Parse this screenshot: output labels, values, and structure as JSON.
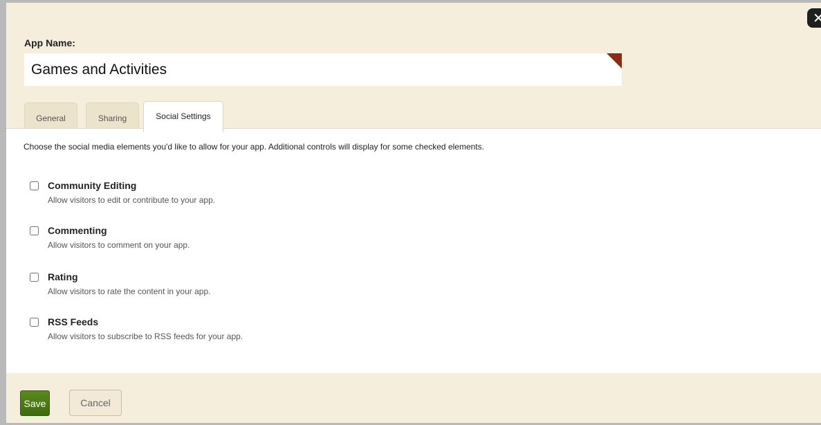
{
  "dialog": {
    "close_icon": "close-icon",
    "app_name_label": "App Name:",
    "app_name_value": "Games and Activities"
  },
  "tabs": [
    {
      "label": "General",
      "active": false
    },
    {
      "label": "Sharing",
      "active": false
    },
    {
      "label": "Social Settings",
      "active": true
    }
  ],
  "social": {
    "intro": "Choose the social media elements you'd like to allow for your app. Additional controls will display for some checked elements.",
    "options": [
      {
        "title": "Community Editing",
        "description": "Allow visitors to edit or contribute to your app.",
        "checked": false
      },
      {
        "title": "Commenting",
        "description": "Allow visitors to comment on your app.",
        "checked": false
      },
      {
        "title": "Rating",
        "description": "Allow visitors to rate the content in your app.",
        "checked": false
      },
      {
        "title": "RSS Feeds",
        "description": "Allow visitors to subscribe to RSS feeds for your app.",
        "checked": false
      }
    ]
  },
  "footer": {
    "save_label": "Save",
    "cancel_label": "Cancel"
  },
  "colors": {
    "background": "#f5eedc",
    "accent_corner": "#8b2d12",
    "save_button": "#4a7a15"
  }
}
